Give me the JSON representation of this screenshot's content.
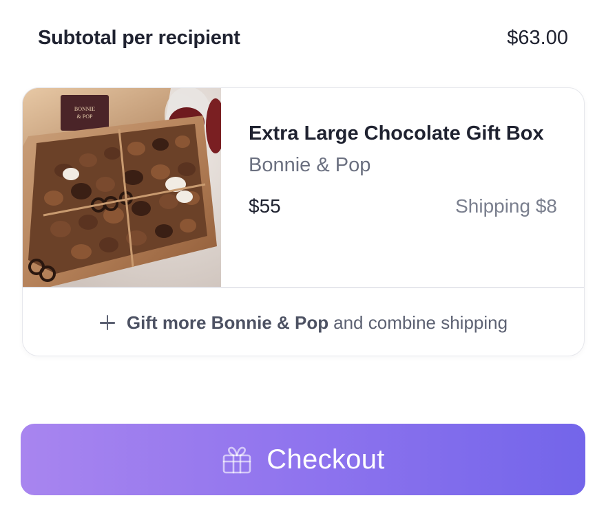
{
  "subtotal": {
    "label": "Subtotal per recipient",
    "value": "$63.00"
  },
  "product": {
    "title": "Extra Large Chocolate Gift Box",
    "brand": "Bonnie & Pop",
    "price": "$55",
    "shipping": "Shipping $8",
    "image_icon": "chocolate-box-photo",
    "image_box_lettering": "BONNIE & POP"
  },
  "gift_more": {
    "icon": "plus-icon",
    "strong": "Gift more Bonnie & Pop",
    "rest": "and combine shipping"
  },
  "checkout": {
    "label": "Checkout",
    "icon": "gift-icon"
  },
  "colors": {
    "checkout_gradient_start": "#a885ef",
    "checkout_gradient_end": "#7365ea",
    "text_primary": "#1f2230",
    "text_secondary": "#6b7080"
  }
}
